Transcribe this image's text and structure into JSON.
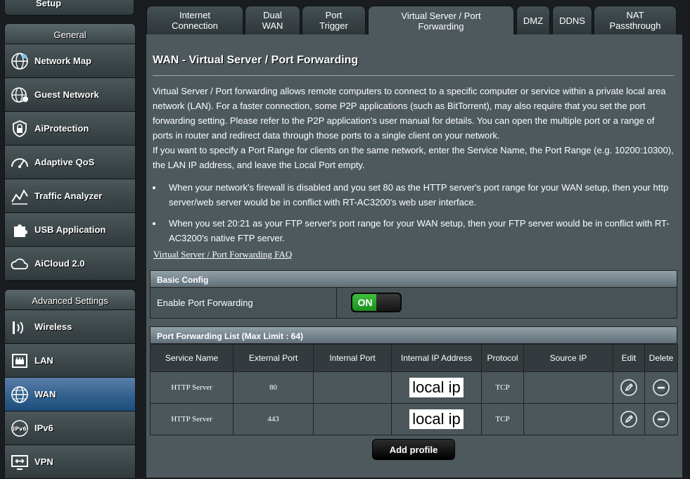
{
  "sidebar": {
    "setup_label": "Setup",
    "general_title": "General",
    "general_items": [
      {
        "label": "Network Map",
        "icon": "globe-network-icon"
      },
      {
        "label": "Guest Network",
        "icon": "guest-globe-icon"
      },
      {
        "label": "AiProtection",
        "icon": "lock-shield-icon"
      },
      {
        "label": "Adaptive QoS",
        "icon": "speedometer-icon"
      },
      {
        "label": "Traffic Analyzer",
        "icon": "chart-icon"
      },
      {
        "label": "USB Application",
        "icon": "puzzle-icon"
      },
      {
        "label": "AiCloud 2.0",
        "icon": "cloud-icon"
      }
    ],
    "advanced_title": "Advanced Settings",
    "advanced_items": [
      {
        "label": "Wireless",
        "icon": "wifi-icon"
      },
      {
        "label": "LAN",
        "icon": "lan-icon"
      },
      {
        "label": "WAN",
        "icon": "globe-icon",
        "active": true
      },
      {
        "label": "IPv6",
        "icon": "ipv6-icon"
      },
      {
        "label": "VPN",
        "icon": "vpn-icon"
      }
    ]
  },
  "tabs": [
    {
      "label": "Internet Connection"
    },
    {
      "label": "Dual WAN"
    },
    {
      "label": "Port Trigger"
    },
    {
      "label": "Virtual Server / Port Forwarding",
      "active": true
    },
    {
      "label": "DMZ"
    },
    {
      "label": "DDNS"
    },
    {
      "label": "NAT Passthrough"
    }
  ],
  "page": {
    "title": "WAN - Virtual Server / Port Forwarding",
    "description_1": "Virtual Server / Port forwarding allows remote computers to connect to a specific computer or service within a private local area network (LAN). For a faster connection, some P2P applications (such as BitTorrent), may also require that you set the port forwarding setting. Please refer to the P2P application's user manual for details. You can open the multiple port or a range of ports in router and redirect data through those ports to a single client on your network.",
    "description_2": "If you want to specify a Port Range for clients on the same network, enter the Service Name, the Port Range (e.g. 10200:10300), the LAN IP address, and leave the Local Port empty.",
    "bullet_1": "When your network's firewall is disabled and you set 80 as the HTTP server's port range for your WAN setup, then your http server/web server would be in conflict with RT-AC3200's web user interface.",
    "bullet_2": "When you set 20:21 as your FTP server's port range for your WAN setup, then your FTP server would be in conflict with RT-AC3200's native FTP server.",
    "faq_link": "Virtual Server / Port Forwarding FAQ"
  },
  "basic_config": {
    "title": "Basic Config",
    "enable_label": "Enable Port Forwarding",
    "toggle_state": "ON"
  },
  "port_list": {
    "title": "Port Forwarding List (Max Limit : 64)",
    "columns": [
      "Service Name",
      "External Port",
      "Internal Port",
      "Internal IP Address",
      "Protocol",
      "Source IP",
      "Edit",
      "Delete"
    ],
    "rows": [
      {
        "service": "HTTP Server",
        "external": "80",
        "internal": "",
        "ip": "local ip",
        "protocol": "TCP",
        "source": ""
      },
      {
        "service": "HTTP Server",
        "external": "443",
        "internal": "",
        "ip": "local ip",
        "protocol": "TCP",
        "source": ""
      }
    ],
    "add_label": "Add profile"
  },
  "colors": {
    "panel": "#4d595d",
    "active_nav": "#33618e",
    "toggle_on": "#2aa62c"
  }
}
